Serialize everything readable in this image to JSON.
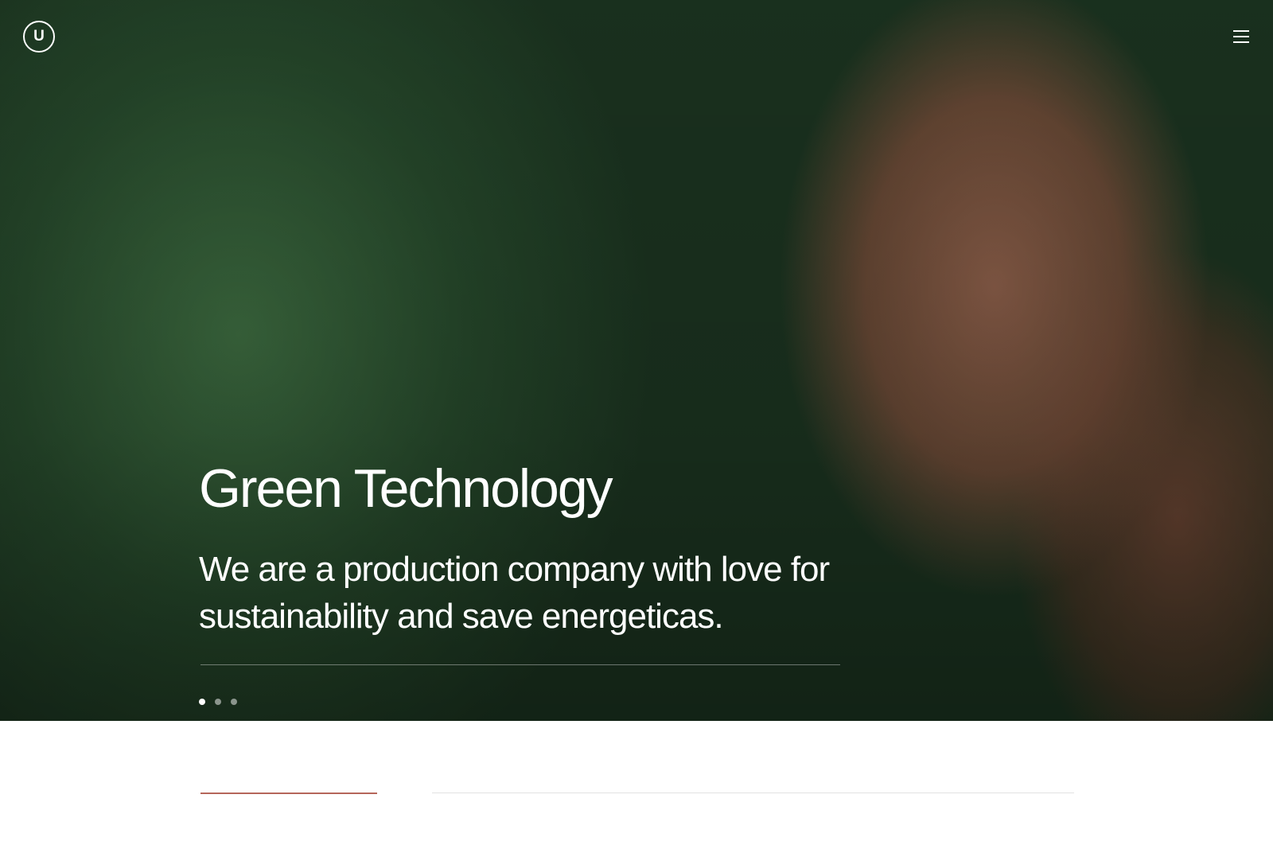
{
  "header": {
    "logo_letter": "U",
    "logo_icon": "u-circle-logo-icon",
    "menu_icon": "hamburger-menu-icon"
  },
  "hero": {
    "title": "Green Technology",
    "subtitle": "We are a production company with love for sustainability and save energeticas.",
    "slides": {
      "count": 3,
      "active_index": 0
    }
  },
  "colors": {
    "text_on_image": "#ffffff",
    "accent_rule": "#b5665a",
    "muted_rule": "#e2e2e2",
    "page_background": "#ffffff"
  }
}
